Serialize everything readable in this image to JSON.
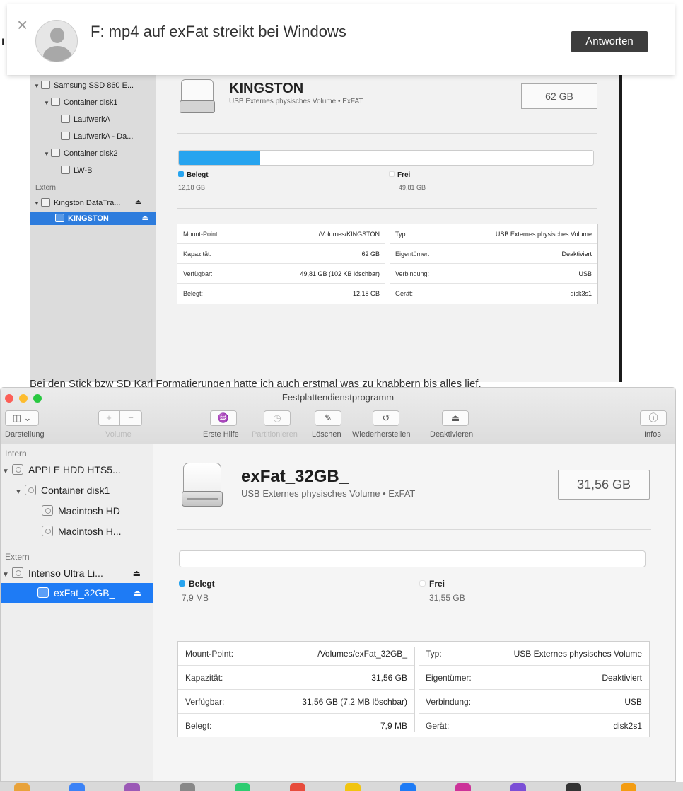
{
  "forum": {
    "fragment": "ı",
    "subject": "F:  mp4 auf exFat streikt bei Windows",
    "reply_label": "Antworten",
    "caption": "Bei den Stick bzw SD Karl Formatierungen hatte ich auch erstmal was zu knabbern bis alles lief."
  },
  "old_screenshot": {
    "sidebar": [
      {
        "label": "Samsung SSD 860 E...",
        "tri": "▼",
        "indent": 0
      },
      {
        "label": "Container disk1",
        "tri": "▼",
        "indent": 1
      },
      {
        "label": "LaufwerkA",
        "tri": "",
        "indent": 2
      },
      {
        "label": "LaufwerkA - Da...",
        "tri": "",
        "indent": 2
      },
      {
        "label": "Container disk2",
        "tri": "▼",
        "indent": 1
      },
      {
        "label": "LW-B",
        "tri": "",
        "indent": 2
      }
    ],
    "group_extern": "Extern",
    "external_drive": "Kingston DataTra...",
    "selected_volume": "KINGSTON",
    "eject": "⏏",
    "volume_name": "KINGSTON",
    "volume_sub": "USB Externes physisches Volume • ExFAT",
    "capacity": "62 GB",
    "used_fraction": 0.196,
    "used_label": "Belegt",
    "used_value": "12,18 GB",
    "free_label": "Frei",
    "free_value": "49,81 GB",
    "table_left": [
      {
        "k": "Mount-Point:",
        "v": "/Volumes/KINGSTON"
      },
      {
        "k": "Kapazität:",
        "v": "62 GB"
      },
      {
        "k": "Verfügbar:",
        "v": "49,81 GB (102 KB löschbar)"
      },
      {
        "k": "Belegt:",
        "v": "12,18 GB"
      }
    ],
    "table_right": [
      {
        "k": "Typ:",
        "v": "USB Externes physisches Volume"
      },
      {
        "k": "Eigentümer:",
        "v": "Deaktiviert"
      },
      {
        "k": "Verbindung:",
        "v": "USB"
      },
      {
        "k": "Gerät:",
        "v": "disk3s1"
      }
    ]
  },
  "window": {
    "title": "Festplattendienstprogramm",
    "lights": {
      "close": "#fc5f57",
      "minimize": "#fdbc2e",
      "zoom": "#28c840"
    },
    "toolbar": {
      "view_icon": "◫ ⌄",
      "view_label": "Darstellung",
      "plus": "+",
      "minus": "−",
      "volume_label": "Volume",
      "firstaid_icon": "♒",
      "firstaid_label": "Erste Hilfe",
      "partition_icon": "◷",
      "partition_label": "Partitionieren",
      "erase_icon": "✎",
      "erase_label": "Löschen",
      "restore_icon": "↺",
      "restore_label": "Wiederherstellen",
      "unmount_icon": "⏏",
      "unmount_label": "Deaktivieren",
      "info_icon": "ⓘ",
      "info_label": "Infos"
    },
    "sidebar": {
      "group_intern": "Intern",
      "internal": [
        {
          "label": "APPLE HDD HTS5...",
          "tri": "▼",
          "indent": 0
        },
        {
          "label": "Container disk1",
          "tri": "▼",
          "indent": 1
        },
        {
          "label": "Macintosh HD",
          "tri": "",
          "indent": 2
        },
        {
          "label": "Macintosh H...",
          "tri": "",
          "indent": 2
        }
      ],
      "group_extern": "Extern",
      "external_drive": "Intenso Ultra Li...",
      "selected_volume": "exFat_32GB_",
      "eject": "⏏"
    },
    "volume": {
      "name": "exFat_32GB_",
      "subtitle": "USB Externes physisches Volume • ExFAT",
      "capacity": "31,56 GB",
      "used_fraction": 0.0003,
      "used_label": "Belegt",
      "used_value": "7,9 MB",
      "free_label": "Frei",
      "free_value": "31,55 GB",
      "used_color": "#27a4ef",
      "free_color": "#ffffff"
    },
    "info_left": [
      {
        "k": "Mount-Point:",
        "v": "/Volumes/exFat_32GB_"
      },
      {
        "k": "Kapazität:",
        "v": "31,56 GB"
      },
      {
        "k": "Verfügbar:",
        "v": "31,56 GB (7,2 MB löschbar)"
      },
      {
        "k": "Belegt:",
        "v": "7,9 MB"
      }
    ],
    "info_right": [
      {
        "k": "Typ:",
        "v": "USB Externes physisches Volume"
      },
      {
        "k": "Eigentümer:",
        "v": "Deaktiviert"
      },
      {
        "k": "Verbindung:",
        "v": "USB"
      },
      {
        "k": "Gerät:",
        "v": "disk2s1"
      }
    ]
  },
  "dock_colors": [
    "#e8a23a",
    "#3b82f6",
    "#9b59b6",
    "#888888",
    "#2ecc71",
    "#e74c3c",
    "#f1c40f",
    "#1e7bf5",
    "#cc3399",
    "#7b4fd6",
    "#333333",
    "#f39c12"
  ]
}
